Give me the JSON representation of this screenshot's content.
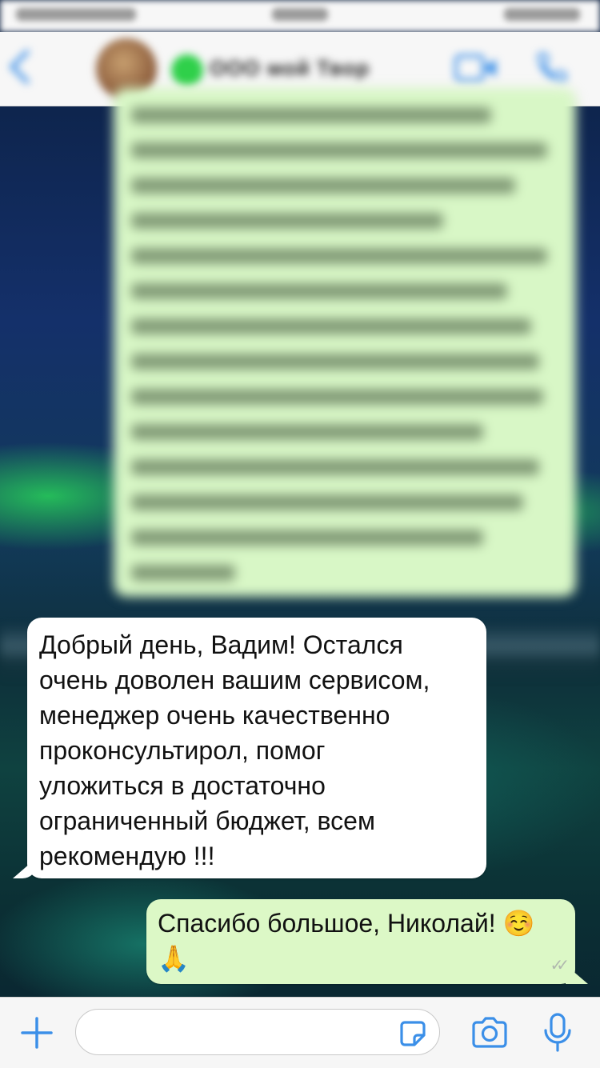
{
  "header": {
    "title": "ООО мой Твор",
    "back_icon": "chevron-left-icon",
    "video_icon": "video-camera-icon",
    "phone_icon": "phone-icon",
    "accent_color": "#3b8fe8"
  },
  "wallpaper": {
    "description_colors": [
      "#0b1f3f",
      "#14306a",
      "#2fd04a"
    ]
  },
  "messages": {
    "incoming": {
      "text": "Добрый день, Вадим! Остался\nочень доволен вашим сервисом,\nменеджер очень качественно\nпроконсультирол, помог\nуложиться в достаточно\nограниченный бюджет, всем\nрекомендую !!!",
      "bubble_color": "#ffffff"
    },
    "outgoing": {
      "text": "Спасибо большое, Николай! ☺️\n🙏",
      "read_ticks": "✓✓",
      "bubble_color": "#dcf8c6"
    }
  },
  "input_bar": {
    "placeholder": "",
    "value": "",
    "icons": [
      "plus-icon",
      "sticker-icon",
      "camera-icon",
      "microphone-icon"
    ]
  }
}
